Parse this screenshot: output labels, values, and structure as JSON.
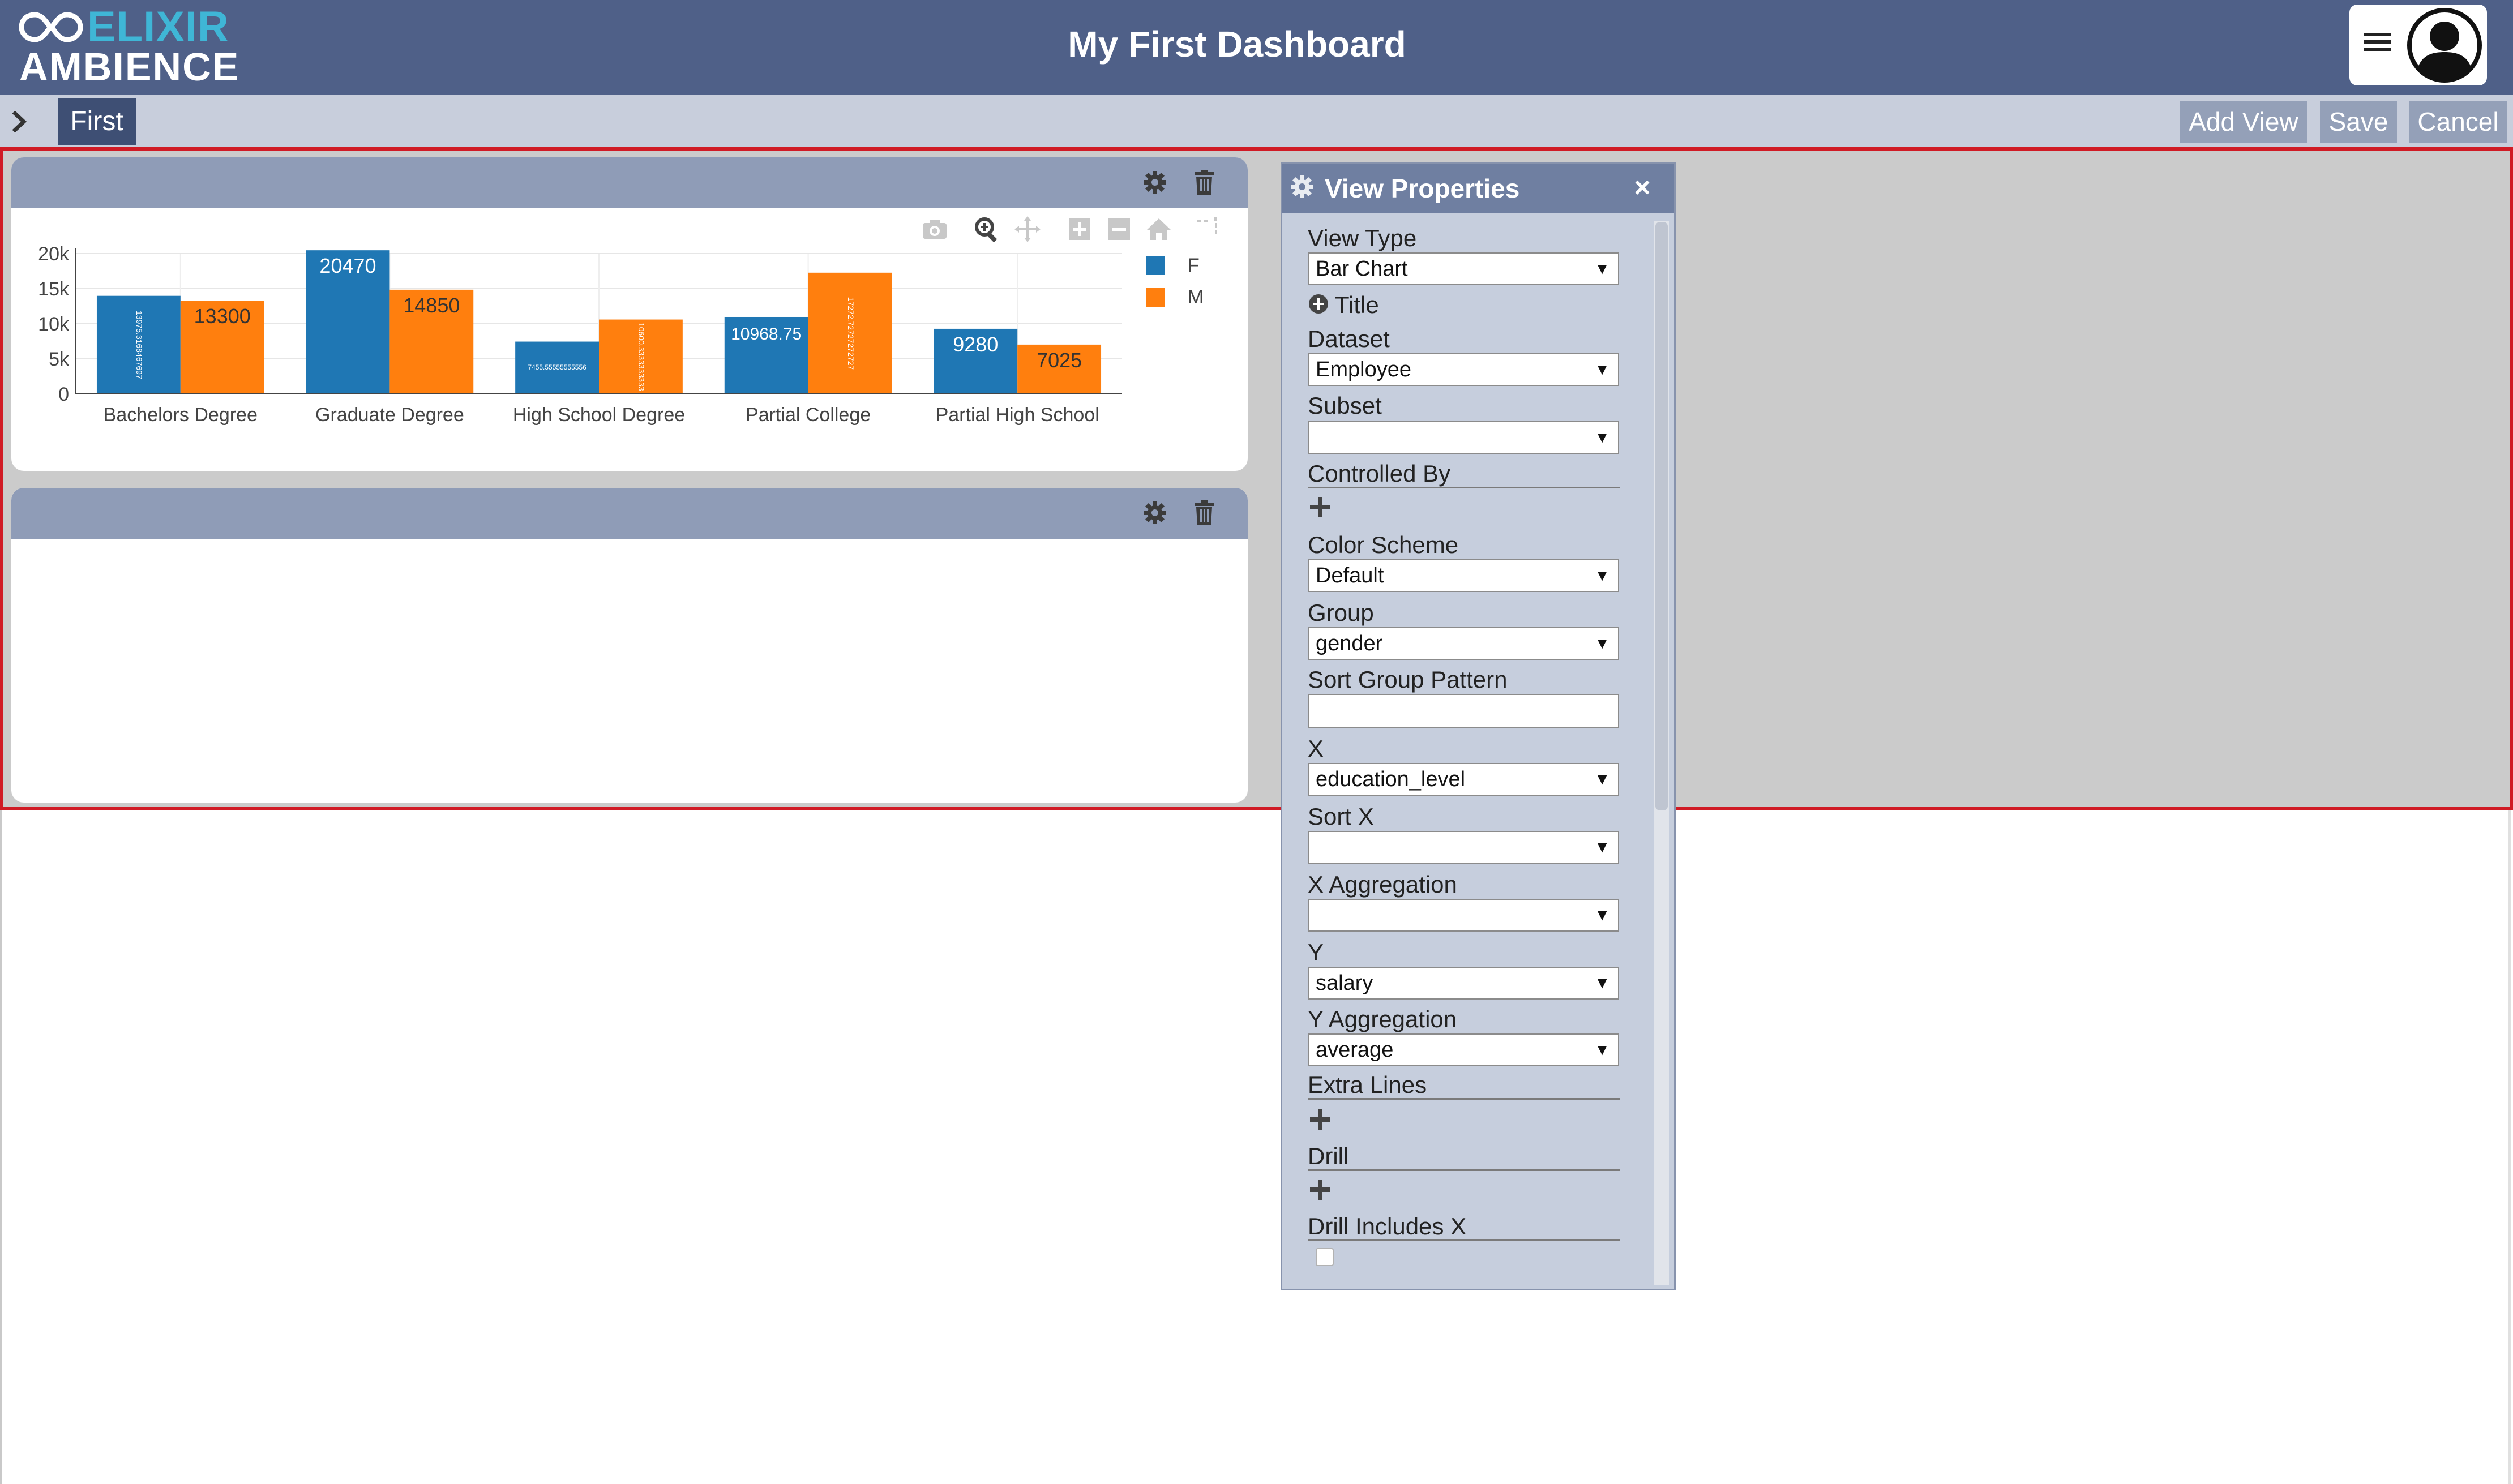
{
  "header": {
    "logo_top": "ELIXIR",
    "logo_bottom": "AMBIENCE",
    "title": "My First Dashboard",
    "colors": {
      "header_bg": "#4f6088",
      "logo_accent": "#3fb6d6"
    }
  },
  "tabbar": {
    "tabs": [
      {
        "label": "First",
        "active": true
      }
    ],
    "buttons": {
      "add_view": "Add View",
      "save": "Save",
      "cancel": "Cancel"
    }
  },
  "panels": [
    {
      "icons": [
        "gear-icon",
        "trash-icon"
      ]
    },
    {
      "icons": [
        "gear-icon",
        "trash-icon"
      ]
    }
  ],
  "chart_modebar": [
    "camera-icon",
    "zoom-icon",
    "pan-icon",
    "zoom-in-icon",
    "zoom-out-icon",
    "home-icon",
    "spike-lines-icon"
  ],
  "chart_data": {
    "type": "bar",
    "title": "",
    "xlabel": "",
    "ylabel": "",
    "categories": [
      "Bachelors Degree",
      "Graduate Degree",
      "High School Degree",
      "Partial College",
      "Partial High School"
    ],
    "series": [
      {
        "name": "F",
        "color": "#1f77b4",
        "values": [
          13975.316846,
          20470,
          7455.555555,
          10968.75,
          9280
        ],
        "labels": [
          "13975.3168467697",
          "20470",
          "7455.55555555556",
          "10968.75",
          "9280"
        ]
      },
      {
        "name": "M",
        "color": "#ff7f0e",
        "values": [
          13300,
          14850,
          10600.3333,
          17272.7272,
          7025
        ],
        "labels": [
          "13300",
          "14850",
          "10600.3333333333",
          "17272.72727272727",
          "7025"
        ]
      }
    ],
    "y_ticks": [
      "0",
      "5k",
      "10k",
      "15k",
      "20k"
    ],
    "ylim": [
      0,
      20000
    ],
    "legend_position": "right",
    "grid": true
  },
  "view_properties": {
    "title": "View Properties",
    "fields": {
      "view_type": {
        "label": "View Type",
        "value": "Bar Chart"
      },
      "title": {
        "label": "Title"
      },
      "dataset": {
        "label": "Dataset",
        "value": "Employee"
      },
      "subset": {
        "label": "Subset",
        "value": ""
      },
      "controlled_by": {
        "label": "Controlled By"
      },
      "color_scheme": {
        "label": "Color Scheme",
        "value": "Default"
      },
      "group": {
        "label": "Group",
        "value": "gender"
      },
      "sort_group_pattern": {
        "label": "Sort Group Pattern",
        "value": ""
      },
      "x": {
        "label": "X",
        "value": "education_level"
      },
      "sort_x": {
        "label": "Sort X",
        "value": ""
      },
      "x_aggregation": {
        "label": "X Aggregation",
        "value": ""
      },
      "y": {
        "label": "Y",
        "value": "salary"
      },
      "y_aggregation": {
        "label": "Y Aggregation",
        "value": "average"
      },
      "extra_lines": {
        "label": "Extra Lines"
      },
      "drill": {
        "label": "Drill"
      },
      "drill_includes_x": {
        "label": "Drill Includes X",
        "checked": false
      }
    }
  }
}
